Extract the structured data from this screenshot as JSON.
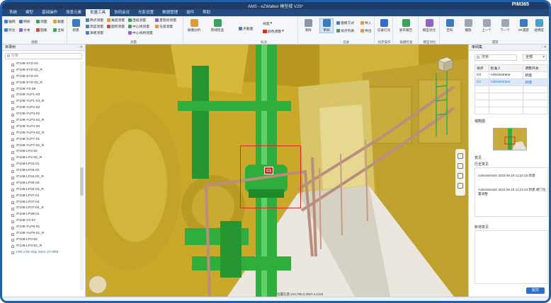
{
  "window": {
    "title": "AMS - eZWalker 模型楼 V25*",
    "brand": "PIM365"
  },
  "menu": [
    "系统",
    "模型",
    "基础操作",
    "场景元素",
    "批量工具",
    "协同会议",
    "光影设置",
    "数据管理",
    "插件",
    "帮助"
  ],
  "ribbon": {
    "view_items": [
      "轴网",
      "网线",
      "测面",
      "截面",
      "标注",
      "文本",
      "图素",
      "全局",
      "新建"
    ],
    "measure_items": [
      "两点测量",
      "角度测量",
      "连续测量",
      "高度测量",
      "面积测量",
      "中心线测量",
      "净距测量",
      "中心线桥测量",
      "直管初测量",
      "任意测量"
    ],
    "measure_group": "测量",
    "buttons": {
      "analyze": "碰撞分析",
      "check": "管线检查",
      "clear": "清除",
      "record_light": "记录灯光",
      "publish": "发布报告",
      "batch": "批量操作",
      "model_compare": "模型对比",
      "transparent": "透明度",
      "vr": "VR漫游",
      "wiki": "百科",
      "play": "播放",
      "prev": "上一个",
      "next": "下一个"
    },
    "point_cloud": "点截面",
    "lines": "线宽",
    "color_label": "颜色调整",
    "groups": {
      "measure": "测量",
      "annotate": "标注",
      "view": "视图",
      "record": "记录",
      "sync": "同步操作",
      "model_check": "碰撞检查",
      "tools": "模型对比",
      "roam": "漫游"
    },
    "record_items": [
      "建模方式",
      "视点列表",
      "导入",
      "导出"
    ],
    "selected_tool": "审阅"
  },
  "left_panel": {
    "title": "目录树",
    "search_placeholder": "检索",
    "items": [
      "/F108-XYZ-02",
      "/F108-XYZ-02_R",
      "/F108-XYZ-03",
      "/F108-XYZ-03_R",
      "/F108-Y0-08",
      "/F108-YLP1-03",
      "/F108-YLP1-03_R",
      "/F108-YLP2-02",
      "/F108-YLP3-02",
      "/F108-YLP3-02_R",
      "/F108-YLP4-02",
      "/F108-YLP4-02_R",
      "/F108-YLP7-01",
      "/F108-YLP7-01_R",
      "/F108-LP2-02",
      "/F108-LP2-02_R",
      "/F108-LP31-01",
      "/F108-LP34-02",
      "/F108-LP34-02_R",
      "/F108-LP34-03",
      "/F108-LP34-03_R",
      "/F108-LP37-01",
      "/F108-LP37-04",
      "/F108-LP37-04_R",
      "/F108-LP38-01",
      "/F108-Y0-07",
      "/F108-YLP8-01",
      "/F108-YLP8-01_R",
      "/F108-LP3-02",
      "/F108-LP3-02_R",
      "HRLATE ship 2001 of HRM"
    ]
  },
  "viewport": {
    "marker": "C1",
    "status": "位置信息:123,789,2,3027,4,1122"
  },
  "right_panel": {
    "title": "审阅集",
    "search": "搜索",
    "filter": "全部",
    "table": {
      "headers": [
        "视点",
        "批准人",
        "调整开关"
      ],
      "rows": [
        [
          "C0",
          "Administrator",
          "新建"
        ],
        [
          "C1",
          "Administrator",
          "新建"
        ]
      ]
    },
    "thumb_label": "缩略图",
    "opinion_label": "意见",
    "history_label": "历史意见",
    "history": [
      {
        "text": "Administrator 2023.09.19 11:24:16 新建"
      },
      {
        "text": "Administrator 2023.09.19 11:24:33 新建 阀门位置调整"
      }
    ],
    "new_label": "新增意见",
    "submit": "提交"
  },
  "colors": {
    "accent": "#1f5fa8",
    "marker": "#d62d20",
    "pipe_green": "#2fae3e",
    "structure_yellow": "#cfae2c"
  }
}
